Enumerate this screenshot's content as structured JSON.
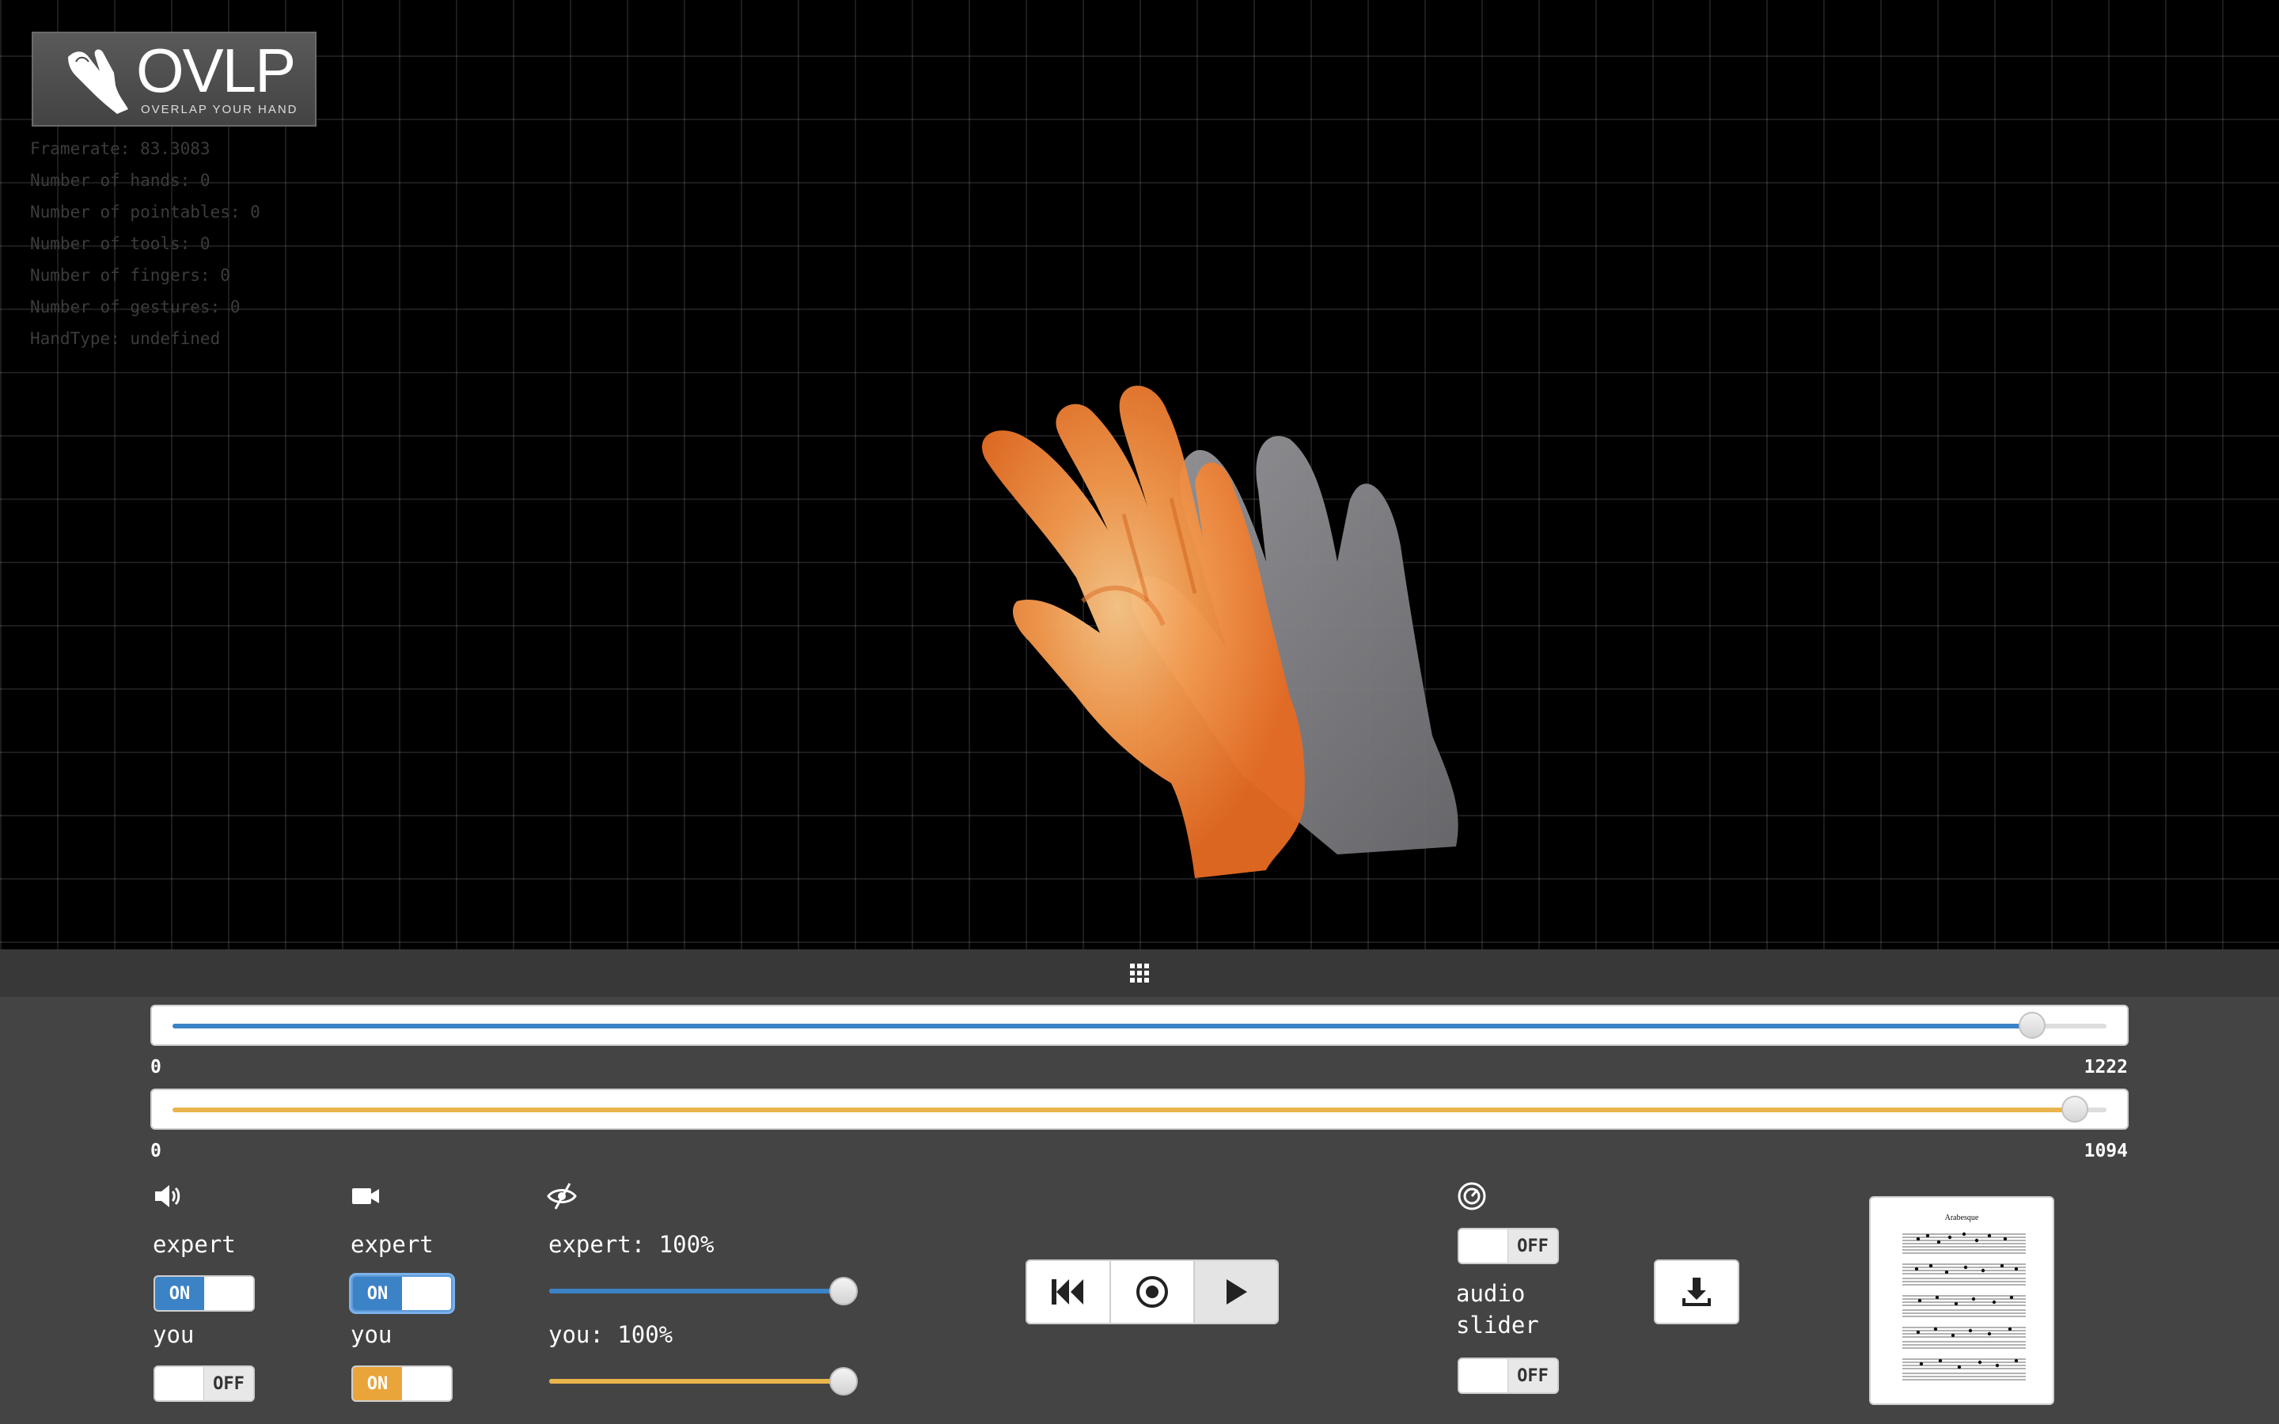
{
  "logo": {
    "wordmark": "OVLP",
    "tagline": "OVERLAP YOUR HAND"
  },
  "stats": [
    "Framerate: 83.3083",
    "Number of hands: 0",
    "Number of pointables: 0",
    "Number of tools: 0",
    "Number of fingers: 0",
    "Number of gestures: 0",
    "HandType: undefined"
  ],
  "timeline": {
    "expert": {
      "min": "0",
      "max": "1222",
      "position_value": 1175,
      "color": "#3c82c6"
    },
    "you": {
      "min": "0",
      "max": "1094",
      "position_value": 1076,
      "color": "#e9b44c"
    }
  },
  "audio": {
    "icon": "volume-icon",
    "expert_label": "expert",
    "you_label": "you",
    "expert_state": {
      "on": "ON",
      "off": ""
    },
    "you_state": {
      "on": "",
      "off": "OFF"
    }
  },
  "video": {
    "icon": "camera-icon",
    "expert_label": "expert",
    "you_label": "you",
    "expert_state": {
      "on": "ON",
      "off": ""
    },
    "you_state": {
      "on": "ON",
      "off": ""
    }
  },
  "opacity": {
    "icon": "eye-hide-icon",
    "expert_label": "expert: 100%",
    "you_label": "you: 100%",
    "expert_value": 1.0,
    "you_value": 1.0
  },
  "transport": {
    "icons": [
      "rewind-icon",
      "record-icon",
      "play-icon"
    ]
  },
  "speed": {
    "icon": "speedometer-icon",
    "toggle_state": {
      "on": "",
      "off": "OFF"
    },
    "audio_slider_line1": "audio",
    "audio_slider_line2": "slider",
    "audio_slider_state": {
      "on": "",
      "off": "OFF"
    }
  },
  "download": {
    "icon": "download-icon"
  },
  "sheet_music": {
    "title": "Arabesque"
  },
  "colors": {
    "panel": "#444444",
    "expert": "#3c82c6",
    "you": "#e9b44c",
    "hand": "#f08a3a"
  }
}
